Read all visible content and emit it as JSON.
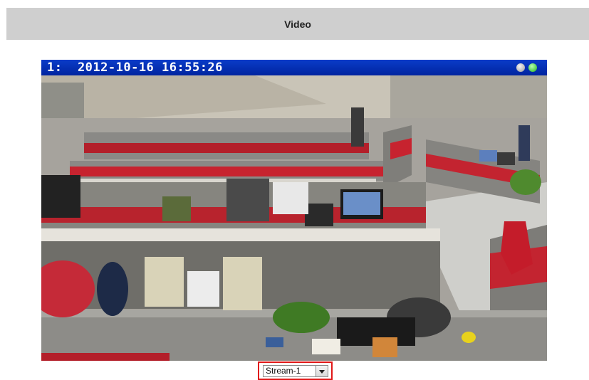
{
  "header": {
    "title": "Video"
  },
  "video": {
    "overlay_text": "1:  2012-10-16 16:55:26",
    "controls": {
      "grey_color": "#a9a9a9",
      "green_color": "#22c41c"
    },
    "bar_color": "#0a2fb8"
  },
  "stream": {
    "selected": "Stream-1",
    "highlight_color": "#e01818"
  }
}
